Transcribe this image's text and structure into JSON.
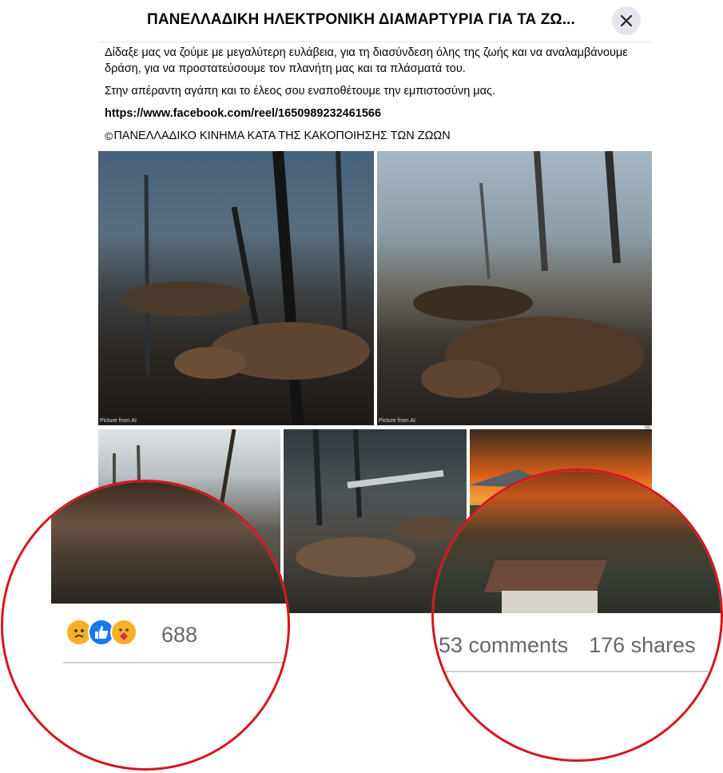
{
  "header": {
    "title": "ΠΑΝΕΛΛΑΔΙΚΗ ΗΛΕΚΤΡΟΝΙΚΗ ΔΙΑΜΑΡΤΥΡΙΑ ΓΙΑ ΤΑ ΖΩ...",
    "close_icon": "close-icon"
  },
  "post": {
    "paragraph_1": "Δίδαξε μας να ζούμε με μεγαλύτερη ευλάβεια, για τη διασύνδεση όλης της ζωής και να αναλαμβάνουμε δράση, για να προστατεύσουμε τον πλανήτη μας και τα πλάσματά του.",
    "paragraph_2": "Στην απέραντη αγάπη και το έλεος σου εναποθέτουμε την εμπιστοσύνη μας.",
    "link": "https://www.facebook.com/reel/1650989232461566",
    "copyright_symbol": "©",
    "copyright_text": "ΠΑΝΕΛΛΑΔΙΚΟ ΚΙΝΗΜΑ ΚΑΤΑ ΤΗΣ ΚΑΚΟΠΟΙΗΣΗΣ ΤΩΝ ΖΩΩΝ"
  },
  "photos": {
    "ai_label": "Picture from AI"
  },
  "engagement": {
    "reactions": [
      "sad",
      "like",
      "care"
    ],
    "reaction_count": "688",
    "comments": "53 comments",
    "shares": "176 shares"
  },
  "colors": {
    "highlight_circle": "#d5161e",
    "like_blue": "#1877f2",
    "muted_text": "#65676b"
  }
}
